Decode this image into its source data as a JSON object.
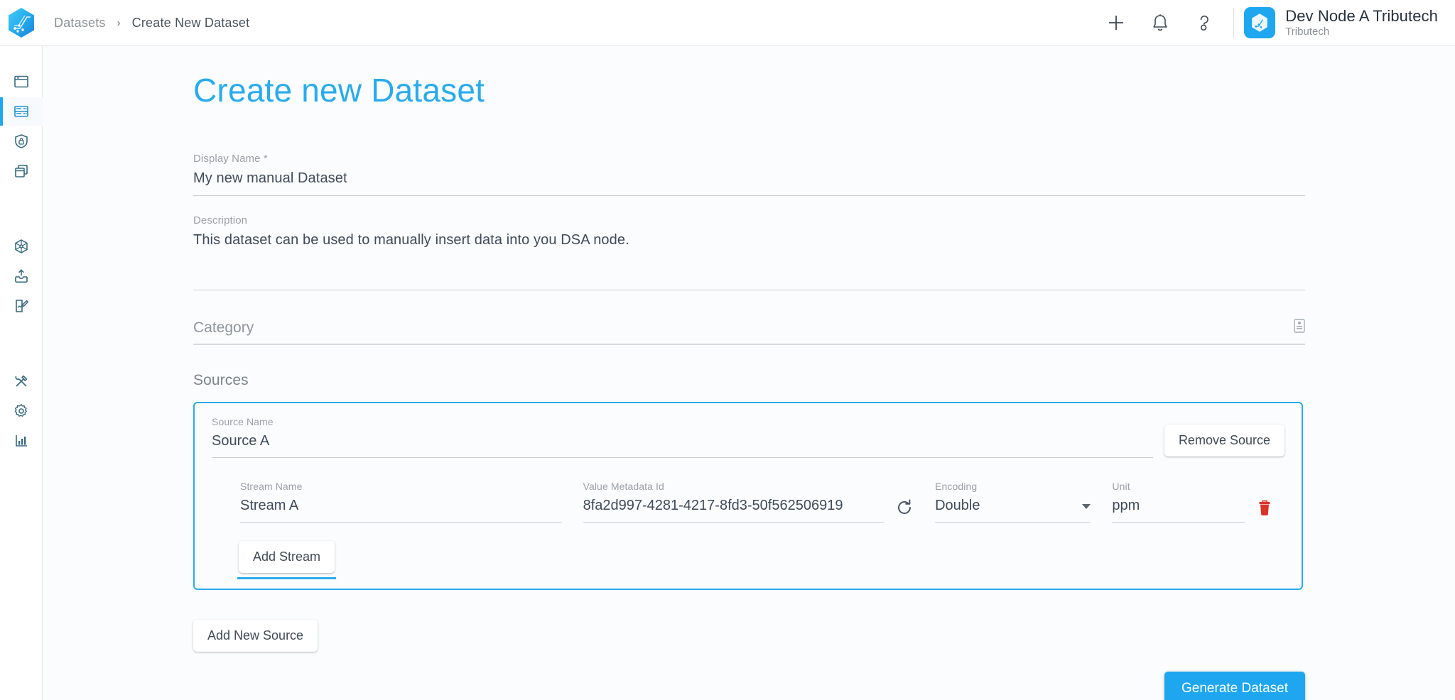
{
  "header": {
    "logo_icon": "tributech-hex-logo",
    "breadcrumb": {
      "root": "Datasets",
      "separator": "›",
      "current": "Create New Dataset"
    },
    "actions": [
      {
        "name": "add-icon",
        "glyph": "+"
      },
      {
        "name": "notifications-bell-icon",
        "glyph": "bell"
      },
      {
        "name": "help-icon",
        "glyph": "question"
      }
    ],
    "account": {
      "avatar_icon": "tributech-node-avatar",
      "name": "Dev Node A Tributech",
      "organization": "Tributech"
    }
  },
  "sidebar": {
    "items": [
      {
        "name": "sidebar-item-overview",
        "icon": "window-icon",
        "active": false
      },
      {
        "name": "sidebar-item-datasets",
        "icon": "server-rack-icon",
        "active": true
      },
      {
        "name": "sidebar-item-security",
        "icon": "shield-lock-icon",
        "active": false
      },
      {
        "name": "sidebar-item-copies",
        "icon": "layers-copy-icon",
        "active": false
      },
      {
        "name": "sidebar-item-network",
        "icon": "network-hub-icon",
        "active": false
      },
      {
        "name": "sidebar-item-upload",
        "icon": "upload-inbox-icon",
        "active": false
      },
      {
        "name": "sidebar-item-edit",
        "icon": "edit-document-icon",
        "active": false
      },
      {
        "name": "sidebar-item-tools",
        "icon": "tools-icon",
        "active": false
      },
      {
        "name": "sidebar-item-settings",
        "icon": "gear-icon",
        "active": false
      },
      {
        "name": "sidebar-item-analytics",
        "icon": "bar-chart-icon",
        "active": false
      }
    ]
  },
  "page": {
    "title": "Create new Dataset"
  },
  "form": {
    "display_name": {
      "label": "Display Name *",
      "value": "My new manual Dataset"
    },
    "description": {
      "label": "Description",
      "value": "This dataset can be used to manually insert data into you DSA node."
    },
    "category": {
      "placeholder": "Category",
      "value": "",
      "icon": "category-list-icon"
    },
    "sources_heading": "Sources"
  },
  "source": {
    "name_label": "Source Name",
    "name_value": "Source A",
    "remove_label": "Remove Source",
    "add_stream_label": "Add Stream",
    "stream": {
      "stream_name_label": "Stream Name",
      "stream_name_value": "Stream A",
      "metadata_label": "Value Metadata Id",
      "metadata_value": "8fa2d997-4281-4217-8fd3-50f562506919",
      "refresh_icon": "refresh-icon",
      "encoding_label": "Encoding",
      "encoding_value": "Double",
      "unit_label": "Unit",
      "unit_value": "ppm",
      "delete_icon": "trash-icon"
    }
  },
  "actions": {
    "add_new_source": "Add New Source",
    "generate_dataset": "Generate Dataset"
  },
  "colors": {
    "accent": "#29ABEC",
    "primary_button": "#1EA7F0",
    "rail_icon": "#36687f",
    "danger": "#d7342a",
    "muted_text": "#9aa0a6",
    "value_text": "#3e4b5b"
  }
}
